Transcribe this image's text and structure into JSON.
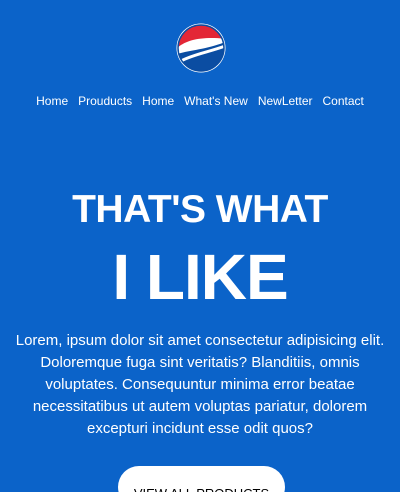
{
  "nav": {
    "items": [
      "Home",
      "Prouducts",
      "Home",
      "What's New",
      "NewLetter",
      "Contact"
    ]
  },
  "hero": {
    "headline_line1": "THAT'S WHAT",
    "headline_line2": "I LIKE",
    "body": "Lorem, ipsum dolor sit amet consectetur adipisicing elit. Doloremque fuga sint veritatis? Blanditiis, omnis voluptates. Consequuntur minima error beatae necessitatibus ut autem voluptas pariatur, dolorem excepturi incidunt esse odit quos?",
    "cta_label": "VIEW ALL PRODUCTS"
  },
  "colors": {
    "background": "#0b63c9",
    "text": "#ffffff",
    "button_background": "#ffffff",
    "logo_red": "#e32636",
    "logo_blue": "#0b4da2"
  },
  "icons": {
    "logo": "pepsi-globe-logo"
  }
}
